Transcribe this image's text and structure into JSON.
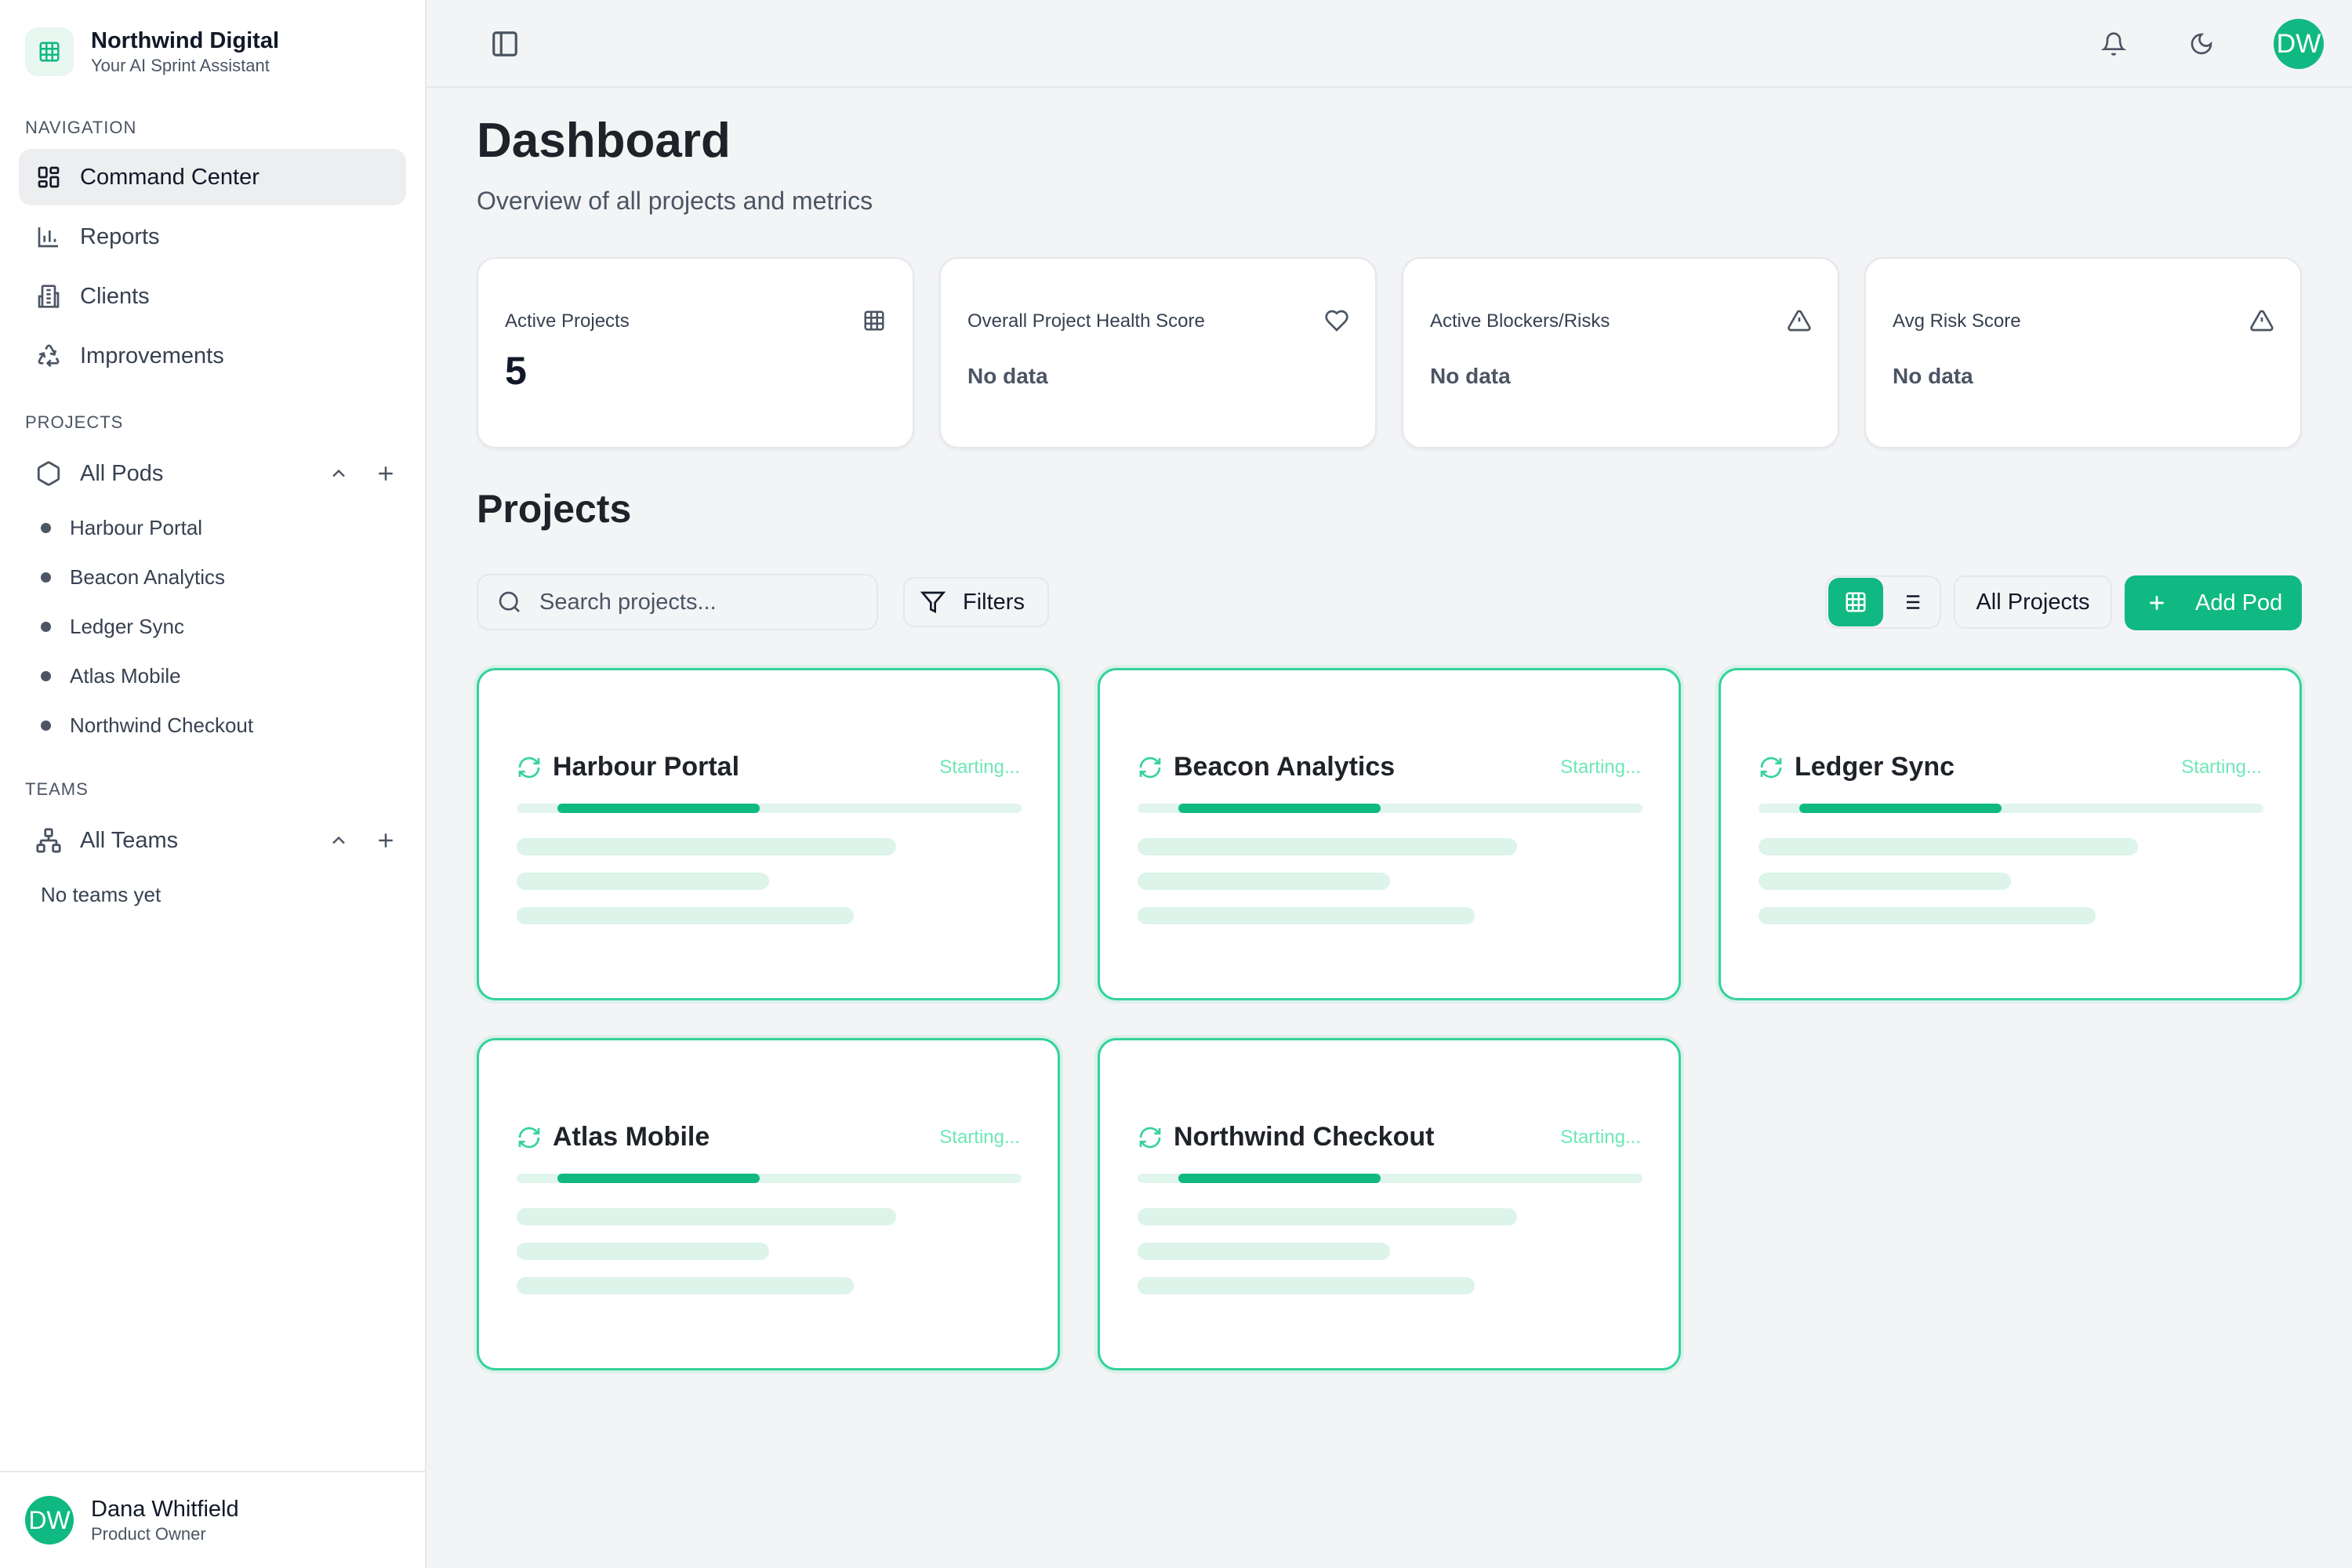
{
  "brand": {
    "name": "Northwind Digital",
    "subtitle": "Your AI Sprint Assistant",
    "logo_icon": "grid-icon"
  },
  "nav": {
    "section_title": "NAVIGATION",
    "items": [
      {
        "label": "Command Center",
        "icon": "dashboard-icon",
        "active": true
      },
      {
        "label": "Reports",
        "icon": "bar-chart-icon"
      },
      {
        "label": "Clients",
        "icon": "building-icon"
      },
      {
        "label": "Improvements",
        "icon": "recycle-icon"
      }
    ]
  },
  "projects_section": {
    "section_title": "PROJECTS",
    "group_label": "All Pods",
    "items": [
      "Harbour Portal",
      "Beacon Analytics",
      "Ledger Sync",
      "Atlas Mobile",
      "Northwind Checkout"
    ]
  },
  "teams_section": {
    "section_title": "TEAMS",
    "group_label": "All Teams",
    "empty_text": "No teams yet"
  },
  "user": {
    "initials": "DW",
    "name": "Dana Whitfield",
    "role": "Product Owner"
  },
  "topbar": {
    "avatar_initials": "DW"
  },
  "page": {
    "title": "Dashboard",
    "subtitle": "Overview of all projects and metrics"
  },
  "stats": [
    {
      "label": "Active Projects",
      "value": "5",
      "icon": "grid-icon"
    },
    {
      "label": "Overall Project Health Score",
      "value": "No data",
      "icon": "heart-icon"
    },
    {
      "label": "Active Blockers/Risks",
      "value": "No data",
      "icon": "warning-icon"
    },
    {
      "label": "Avg Risk Score",
      "value": "No data",
      "icon": "warning-icon"
    }
  ],
  "projects": {
    "title": "Projects",
    "search_placeholder": "Search projects...",
    "filters_label": "Filters",
    "all_projects_label": "All Projects",
    "add_pod_label": "Add Pod",
    "cards": [
      {
        "name": "Harbour Portal",
        "status": "Starting..."
      },
      {
        "name": "Beacon Analytics",
        "status": "Starting..."
      },
      {
        "name": "Ledger Sync",
        "status": "Starting..."
      },
      {
        "name": "Atlas Mobile",
        "status": "Starting..."
      },
      {
        "name": "Northwind Checkout",
        "status": "Starting..."
      }
    ]
  },
  "colors": {
    "accent": "#10b981",
    "accent_light": "#dcf4e9",
    "card_border": "#34d399"
  }
}
